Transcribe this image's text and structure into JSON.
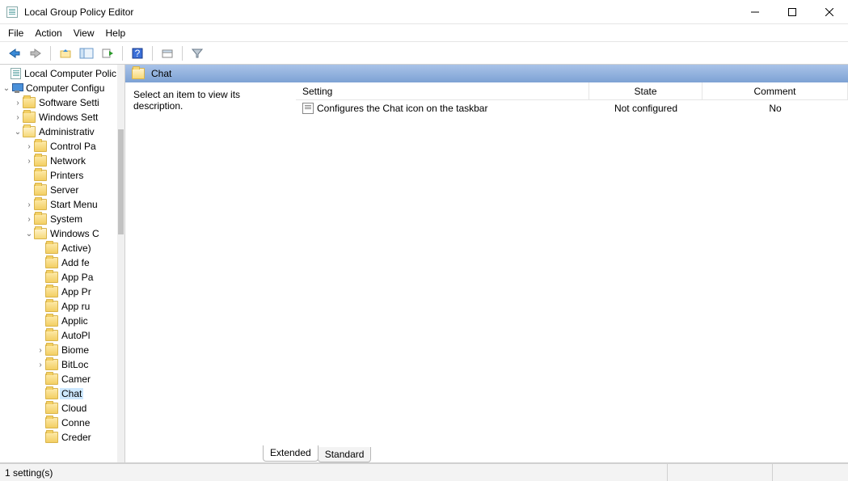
{
  "window": {
    "title": "Local Group Policy Editor"
  },
  "menu": {
    "file": "File",
    "action": "Action",
    "view": "View",
    "help": "Help"
  },
  "tree": {
    "root": "Local Computer Polic",
    "computer_config": "Computer Configu",
    "software_settings": "Software Setti",
    "windows_settings": "Windows Sett",
    "admin_templates": "Administrativ",
    "control_panel": "Control Pa",
    "network": "Network",
    "printers": "Printers",
    "server": "Server",
    "start_menu": "Start Menu",
    "system": "System",
    "windows_components": "Windows C",
    "activex": "Active)",
    "add_features": "Add fe",
    "app_package": "App Pa",
    "app_privacy": "App Pr",
    "app_runtime": "App ru",
    "application": "Applic",
    "autoplay": "AutoPl",
    "biometrics": "Biome",
    "bitlocker": "BitLoc",
    "camera": "Camer",
    "chat": "Chat",
    "cloud": "Cloud",
    "connect": "Conne",
    "credential": "Creder"
  },
  "detail": {
    "header_title": "Chat",
    "description_placeholder": "Select an item to view its description.",
    "columns": {
      "setting": "Setting",
      "state": "State",
      "comment": "Comment"
    },
    "rows": [
      {
        "setting": "Configures the Chat icon on the taskbar",
        "state": "Not configured",
        "comment": "No"
      }
    ]
  },
  "tabs": {
    "extended": "Extended",
    "standard": "Standard"
  },
  "status": {
    "text": "1 setting(s)"
  }
}
